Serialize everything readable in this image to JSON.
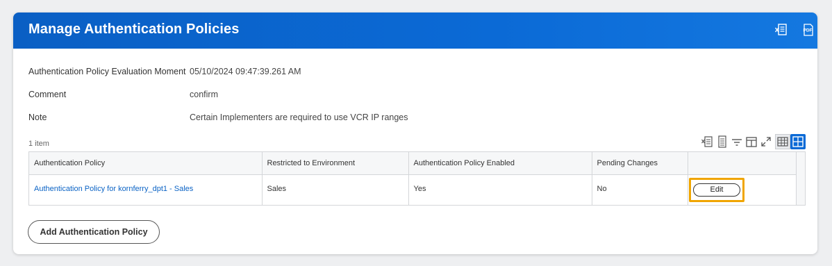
{
  "header": {
    "title": "Manage Authentication Policies",
    "icons": [
      "excel-export-icon",
      "pdf-export-icon"
    ],
    "pdf_label": "PDF"
  },
  "fields": [
    {
      "label": "Authentication Policy Evaluation Moment",
      "value": "05/10/2024 09:47:39.261 AM"
    },
    {
      "label": "Comment",
      "value": "confirm"
    },
    {
      "label": "Note",
      "value": "Certain Implementers are required to use VCR IP ranges"
    }
  ],
  "grid": {
    "count": "1 item",
    "toolbar_icons": [
      "excel-export-icon",
      "print-icon",
      "filter-icon",
      "column-settings-icon",
      "fullscreen-icon",
      "table-view-icon",
      "grid-view-icon"
    ],
    "columns": [
      "Authentication Policy",
      "Restricted to Environment",
      "Authentication Policy Enabled",
      "Pending Changes",
      ""
    ],
    "rows": [
      {
        "policy": "Authentication Policy for kornferry_dpt1 - Sales",
        "environment": "Sales",
        "enabled": "Yes",
        "pending": "No",
        "action": "Edit"
      }
    ]
  },
  "actions": {
    "add_label": "Add Authentication Policy"
  },
  "colors": {
    "header_bg": "#0b6ad6",
    "link": "#0b63c5",
    "highlight": "#f0a500"
  }
}
